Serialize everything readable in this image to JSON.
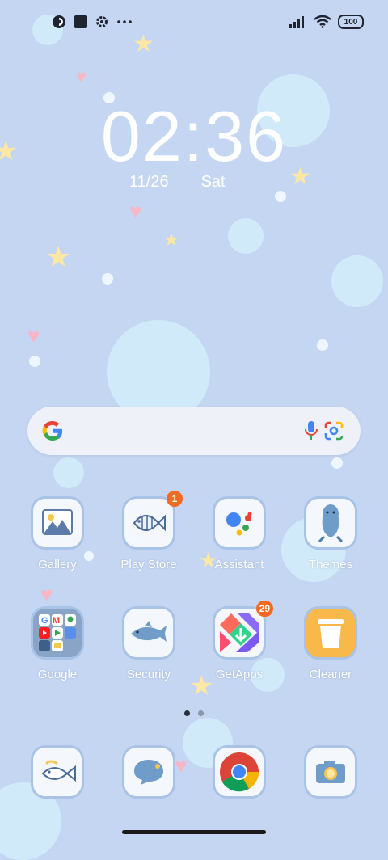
{
  "status_bar": {
    "icons": [
      "app-icon",
      "square-icon",
      "gear-icon",
      "more-icon"
    ],
    "right_icons": [
      "signal-icon",
      "wifi-icon"
    ],
    "battery": "100"
  },
  "clock": {
    "time": "02:36",
    "date": "11/26",
    "weekday": "Sat"
  },
  "search": {
    "icons": [
      "google-g-icon",
      "mic-icon",
      "google-lens-icon"
    ]
  },
  "apps": [
    {
      "label": "Gallery",
      "icon": "gallery-icon"
    },
    {
      "label": "Play Store",
      "icon": "fish-icon",
      "badge": "1"
    },
    {
      "label": "Assistant",
      "icon": "assistant-icon"
    },
    {
      "label": "Themes",
      "icon": "seal-icon"
    },
    {
      "label": "Google",
      "icon": "folder-icon"
    },
    {
      "label": "Security",
      "icon": "shark-icon"
    },
    {
      "label": "GetApps",
      "icon": "getapps-icon",
      "badge": "29"
    },
    {
      "label": "Cleaner",
      "icon": "trash-icon"
    }
  ],
  "dock": [
    {
      "icon": "phone-fish-icon"
    },
    {
      "icon": "message-icon"
    },
    {
      "icon": "chrome-icon"
    },
    {
      "icon": "camera-icon"
    }
  ],
  "page_indicator": {
    "pages": 2,
    "current": 1
  },
  "colors": {
    "background": "#c4d6f2",
    "badge": "#f26a24",
    "icon_border": "#a9c3e6"
  }
}
